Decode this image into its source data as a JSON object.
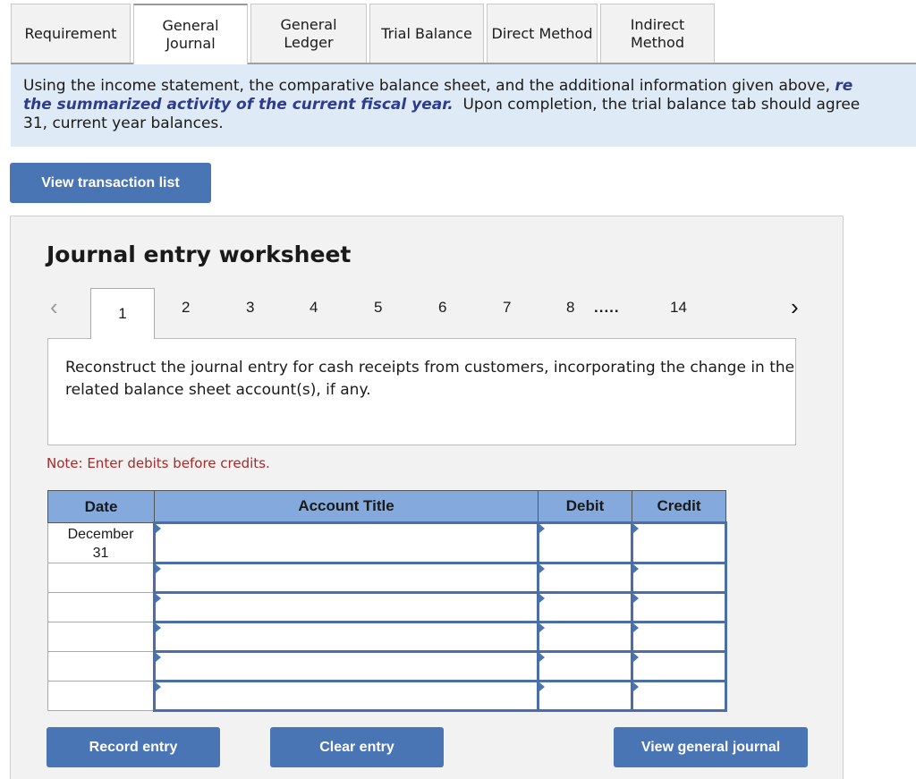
{
  "tabs": [
    {
      "label": "Requirement",
      "active": false
    },
    {
      "label": "General\nJournal",
      "active": true
    },
    {
      "label": "General\nLedger",
      "active": false
    },
    {
      "label": "Trial Balance",
      "active": false
    },
    {
      "label": "Direct Method",
      "active": false
    },
    {
      "label": "Indirect\nMethod",
      "active": false
    }
  ],
  "instructions": {
    "part1": "Using the income statement, the comparative balance sheet, and the additional information given above, ",
    "emphasis": "re",
    "line2_emphasis": "the summarized activity of the current fiscal year.",
    "line2_rest": "  Upon completion, the trial balance tab should agree",
    "line3": "31, current year balances."
  },
  "buttons": {
    "view_transaction_list": "View transaction list",
    "record_entry": "Record entry",
    "clear_entry": "Clear entry",
    "view_general_journal": "View general journal"
  },
  "worksheet": {
    "title": "Journal entry worksheet",
    "pages": [
      "1",
      "2",
      "3",
      "4",
      "5",
      "6",
      "7",
      "8",
      ".....",
      "14"
    ],
    "current_page": "1",
    "prompt": "Reconstruct the journal entry for cash receipts from customers, incorporating the change in the related balance sheet account(s), if any.",
    "note": "Note: Enter debits before credits."
  },
  "table": {
    "headers": {
      "date": "Date",
      "account": "Account Title",
      "debit": "Debit",
      "credit": "Credit"
    },
    "rows": [
      {
        "date": "December\n31",
        "account": "",
        "debit": "",
        "credit": ""
      },
      {
        "date": "",
        "account": "",
        "debit": "",
        "credit": ""
      },
      {
        "date": "",
        "account": "",
        "debit": "",
        "credit": ""
      },
      {
        "date": "",
        "account": "",
        "debit": "",
        "credit": ""
      },
      {
        "date": "",
        "account": "",
        "debit": "",
        "credit": ""
      },
      {
        "date": "",
        "account": "",
        "debit": "",
        "credit": ""
      }
    ]
  }
}
